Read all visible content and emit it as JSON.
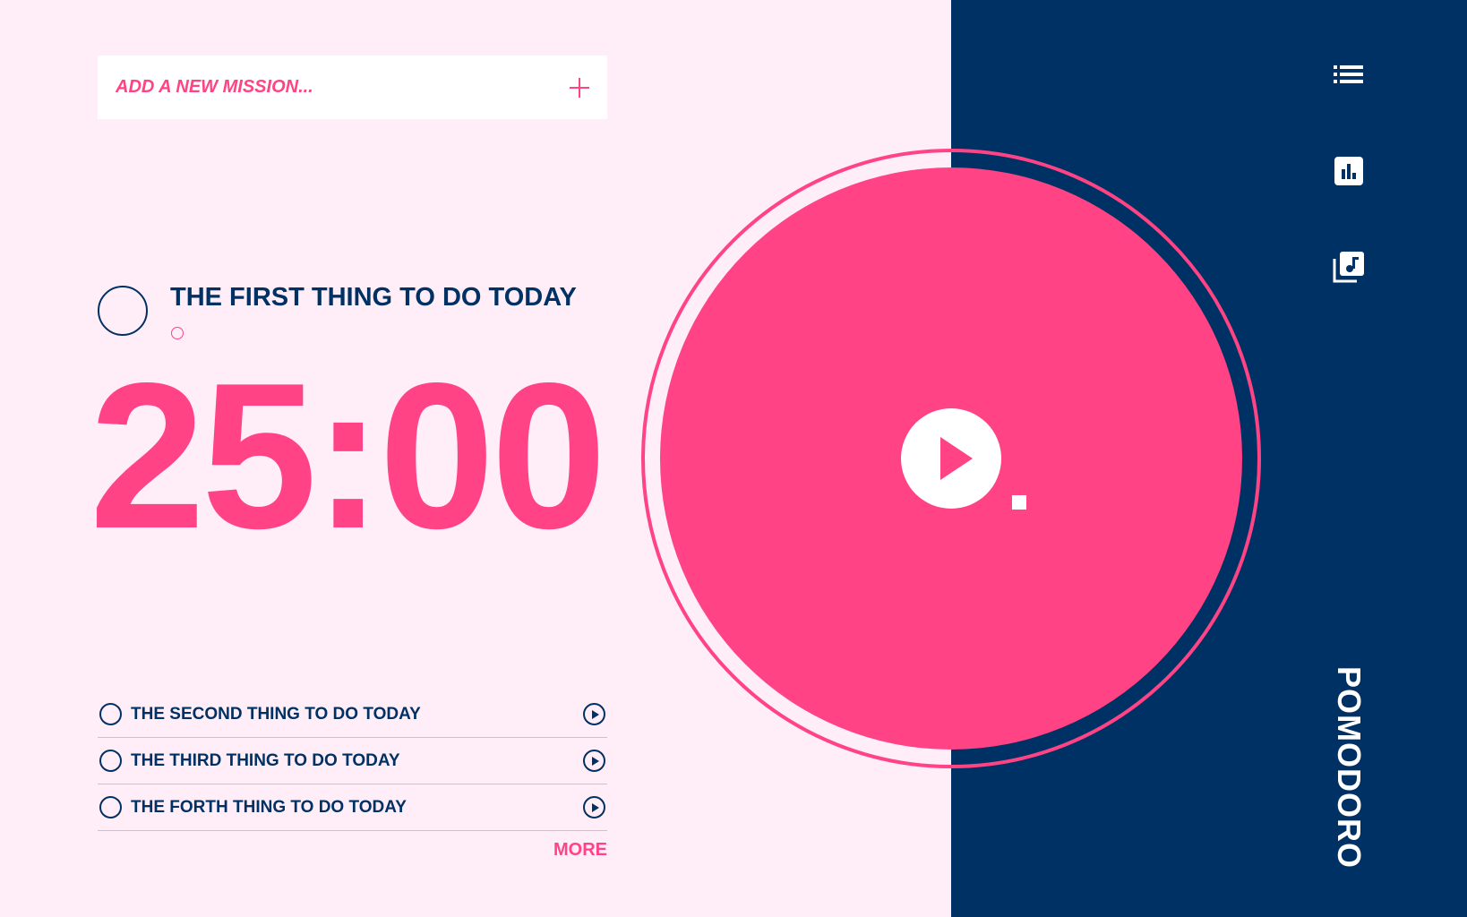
{
  "add_mission": {
    "placeholder": "ADD A NEW MISSION..."
  },
  "current_task": {
    "title": "THE FIRST THING TO DO TODAY"
  },
  "timer": {
    "display": "25:00"
  },
  "tasks": [
    {
      "label": "THE SECOND THING TO DO TODAY"
    },
    {
      "label": "THE THIRD THING TO DO TODAY"
    },
    {
      "label": "THE FORTH THING TO DO TODAY"
    }
  ],
  "more_label": "MORE",
  "brand": "POMODORO",
  "colors": {
    "accent": "#FF4384",
    "navy": "#003164",
    "background": "#FFEDF7",
    "white": "#FFFFFF"
  },
  "icons": {
    "add": "plus-icon",
    "list": "list-icon",
    "analytics": "bar-chart-icon",
    "music": "music-library-icon",
    "play": "play-icon"
  }
}
